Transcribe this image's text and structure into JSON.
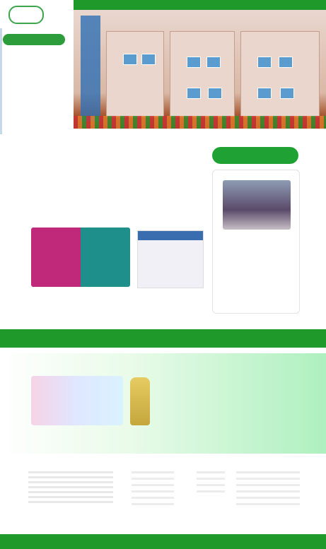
{
  "topbar": {
    "text": ""
  },
  "sidebar": {
    "logo_text": "",
    "heading": "",
    "items": [
      "",
      "",
      "",
      "",
      ""
    ]
  },
  "hero": {
    "alt": ""
  },
  "intro": {
    "text": ""
  },
  "news": {
    "heading": "",
    "caption": ""
  },
  "thumbs": [
    {
      "caption": ""
    },
    {
      "caption": ""
    }
  ],
  "band": {
    "text": ""
  },
  "promo": {
    "title": "",
    "cols": [
      "",
      "",
      ""
    ]
  },
  "footer": {
    "col1_head": "",
    "col2_head": "",
    "col3_head": "",
    "col4_head": "",
    "bottom_left": "",
    "bottom_right": ""
  },
  "colors": {
    "accent": "#1f9a2a",
    "soft_green": "#aef0bf"
  }
}
